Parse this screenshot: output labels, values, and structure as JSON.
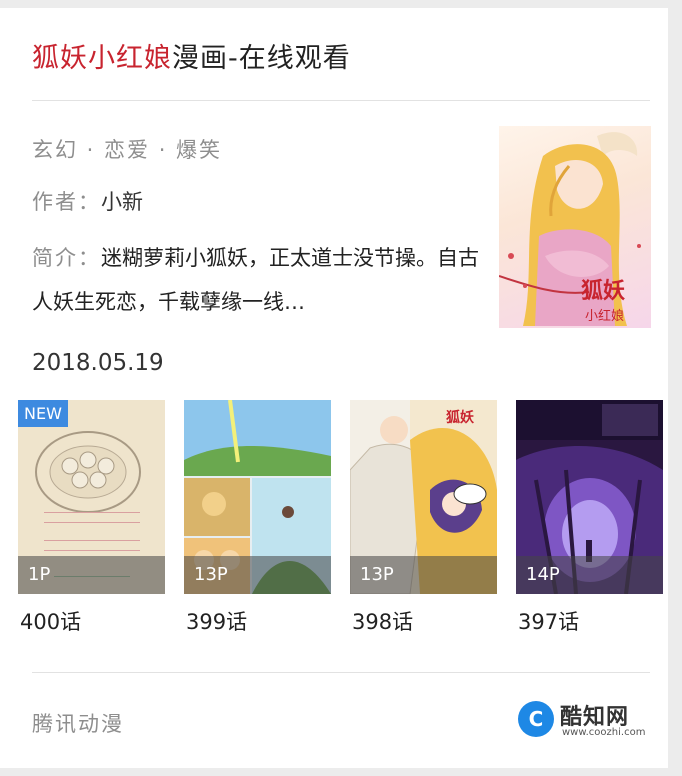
{
  "header": {
    "title_highlight": "狐妖小红娘",
    "title_rest": "漫画-在线观看"
  },
  "info": {
    "tags": "玄幻 · 恋爱 · 爆笑",
    "author_label": "作者：",
    "author": "小新",
    "intro_label": "简介：",
    "intro": "迷糊萝莉小狐妖，正太道士没节操。自古人妖生死恋，千载孽缘一线…",
    "cover_title": "狐妖小红娘"
  },
  "update_date": "2018.05.19",
  "chapters": [
    {
      "label": "400话",
      "pages": "1P",
      "badge": "NEW"
    },
    {
      "label": "399话",
      "pages": "13P"
    },
    {
      "label": "398话",
      "pages": "13P"
    },
    {
      "label": "397话",
      "pages": "14P"
    }
  ],
  "footer": {
    "source": "腾讯动漫"
  },
  "watermark": {
    "name": "酷知网",
    "url": "www.coozhi.com",
    "logo_letter": "C"
  },
  "colors": {
    "title_highlight": "#c8242f",
    "muted_text": "#8e8e8e",
    "new_badge": "#3d8ae0",
    "watermark_logo": "#1e88e5"
  }
}
